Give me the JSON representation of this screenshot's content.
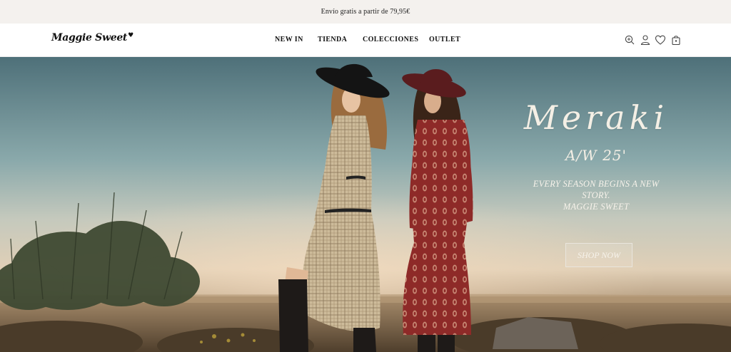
{
  "announcement": {
    "text": "Envío gratis a partir de 79,95€"
  },
  "header": {
    "logo": "Maggie Sweet",
    "logo_mark": "♥",
    "nav": [
      "NEW IN",
      "TIENDA",
      "COLECCIONES",
      "OUTLET"
    ],
    "icons": [
      "search-icon",
      "user-icon",
      "heart-icon",
      "bag-icon"
    ]
  },
  "hero": {
    "title": "Meraki",
    "season": "A/W 25'",
    "tagline_line1": "EVERY SEASON BEGINS A NEW",
    "tagline_line2": "STORY.",
    "tagline_line3": "MAGGIE SWEET",
    "cta": "SHOP NOW"
  },
  "colors": {
    "announcement_bg": "#f4f1ee",
    "header_bg": "#ffffff",
    "text_dark": "#111111",
    "hero_text": "#f4efe5"
  }
}
